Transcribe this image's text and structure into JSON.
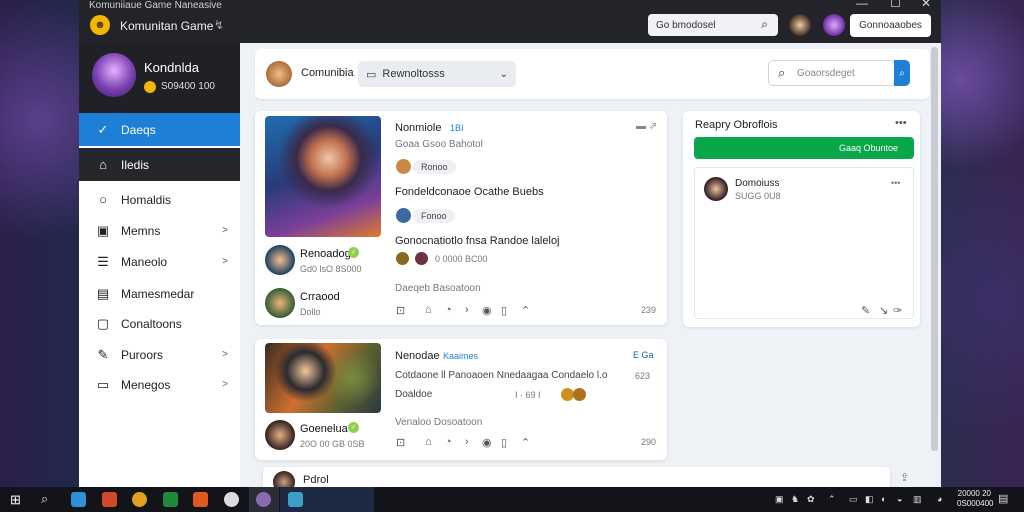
{
  "window": {
    "app_title": "Komuniiaue Game Naneasive",
    "app_name": "Komunitan Game",
    "minimize": "—",
    "maximize": "☐",
    "close": "✕"
  },
  "header": {
    "search_text": "Go bmodosel",
    "button_label": "Gonnoaaobes"
  },
  "profile": {
    "name": "Kondnlda",
    "count": "S09400 100"
  },
  "sidebar": {
    "items": [
      {
        "label": "Daeqs",
        "icon": "check-icon"
      },
      {
        "label": "Iledis",
        "icon": "home-icon"
      },
      {
        "label": "Homaldis",
        "icon": "search-icon"
      },
      {
        "label": "Memns",
        "icon": "message-icon"
      },
      {
        "label": "Maneolo",
        "icon": "list-icon"
      },
      {
        "label": "Mamesmedar",
        "icon": "doc-icon"
      },
      {
        "label": "Conaltoons",
        "icon": "book-icon"
      },
      {
        "label": "Puroors",
        "icon": "brush-icon"
      },
      {
        "label": "Menegos",
        "icon": "chat-icon"
      }
    ]
  },
  "topbar": {
    "community_label": "Comunibia",
    "dropdown_value": "Rewnoltosss",
    "search_placeholder": "Goaorsdeget"
  },
  "post1": {
    "title": "Nonmiole",
    "badge": "1BI",
    "subtitle": "Goaa Gsoo Bahotol",
    "chip1": "Ronoo",
    "line1": "Fondeldconaoe Ocathe Buebs",
    "chip2": "Fonoo",
    "line2": "Gonocnatiotlo fnsa Randoe laleloj",
    "meta": "0 0000 BC00",
    "tag": "Daeqeb Basoatoon",
    "count": "239",
    "user1_name": "Renoadog",
    "user1_sub": "Gd0 lsO 8S000",
    "user2_name": "Crraood",
    "user2_sub": "Dollo"
  },
  "post2": {
    "title": "Nenodae",
    "title_tag": "Kaaimes",
    "corner": "E Ga",
    "line1": "Cotdaone ll Panoaoen Nnedaagaa Condaelo l.o",
    "line1_num": "623",
    "line2": "Doaldoe",
    "line2_meta": "I · 69 I",
    "tag": "Venaloo Dosoatoon",
    "count": "290",
    "user_name": "Goenelua",
    "user_sub": "20O 00 GB 0SB"
  },
  "panel": {
    "title": "Reapry Obroflois",
    "more": "•••",
    "green_button": "Gaaq Obuntoe",
    "item_name": "Domoiuss",
    "item_sub": "SUGG 0U8"
  },
  "comment": {
    "label": "Pdrol"
  },
  "taskbar": {
    "time": "20000 20",
    "date": "0S000400"
  }
}
